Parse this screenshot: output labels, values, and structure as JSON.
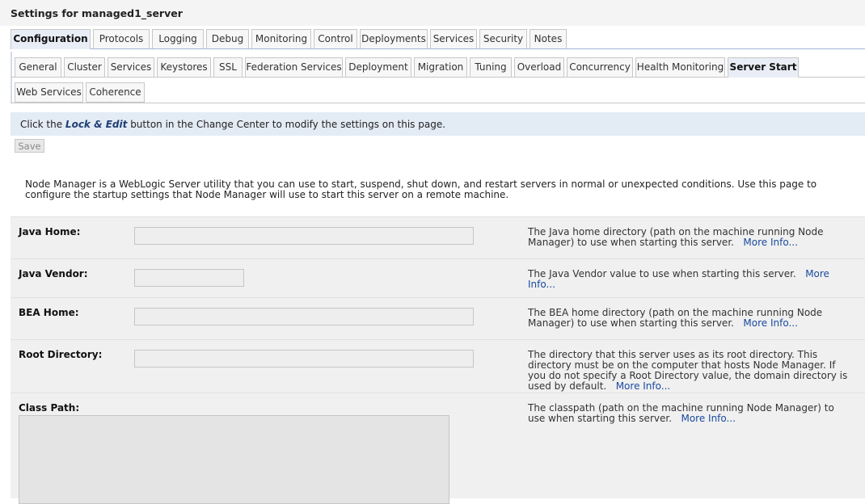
{
  "page_title": "Settings for managed1_server",
  "tabs_primary": [
    {
      "label": "Configuration",
      "active": true
    },
    {
      "label": "Protocols"
    },
    {
      "label": "Logging"
    },
    {
      "label": "Debug"
    },
    {
      "label": "Monitoring"
    },
    {
      "label": "Control"
    },
    {
      "label": "Deployments"
    },
    {
      "label": "Services"
    },
    {
      "label": "Security"
    },
    {
      "label": "Notes"
    }
  ],
  "tabs_secondary": [
    {
      "label": "General"
    },
    {
      "label": "Cluster"
    },
    {
      "label": "Services"
    },
    {
      "label": "Keystores"
    },
    {
      "label": "SSL"
    },
    {
      "label": "Federation Services"
    },
    {
      "label": "Deployment"
    },
    {
      "label": "Migration"
    },
    {
      "label": "Tuning"
    },
    {
      "label": "Overload"
    },
    {
      "label": "Concurrency"
    },
    {
      "label": "Health Monitoring"
    },
    {
      "label": "Server Start",
      "active": true
    }
  ],
  "tabs_tertiary": [
    {
      "label": "Web Services"
    },
    {
      "label": "Coherence"
    }
  ],
  "info": {
    "prefix": "Click the ",
    "lock_edit": "Lock & Edit",
    "suffix": " button in the Change Center to modify the settings on this page."
  },
  "save_label": "Save",
  "description": "Node Manager is a WebLogic Server utility that you can use to start, suspend, shut down, and restart servers in normal or unexpected conditions. Use this page to configure the startup settings that Node Manager will use to start this server on a remote machine.",
  "more_info_label": "More Info...",
  "settings": [
    {
      "label": "Java Home:",
      "value": "",
      "help": "The Java home directory (path on the machine running Node Manager) to use when starting this server."
    },
    {
      "label": "Java Vendor:",
      "value": "",
      "help": "The Java Vendor value to use when starting this server."
    },
    {
      "label": "BEA Home:",
      "value": "",
      "help": "The BEA home directory (path on the machine running Node Manager) to use when starting this server."
    },
    {
      "label": "Root Directory:",
      "value": "",
      "help": "The directory that this server uses as its root directory. This directory must be on the computer that hosts Node Manager. If you do not specify a Root Directory value, the domain directory is used by default."
    },
    {
      "label": "Class Path:",
      "value": "",
      "help": "The classpath (path on the machine running Node Manager) to use when starting this server."
    }
  ],
  "colors": {
    "active_tab_bg": "#e9eef6",
    "info_bg": "#e3ebf5",
    "link": "#1a4aa0",
    "row_bg": "#f0f0f0"
  }
}
